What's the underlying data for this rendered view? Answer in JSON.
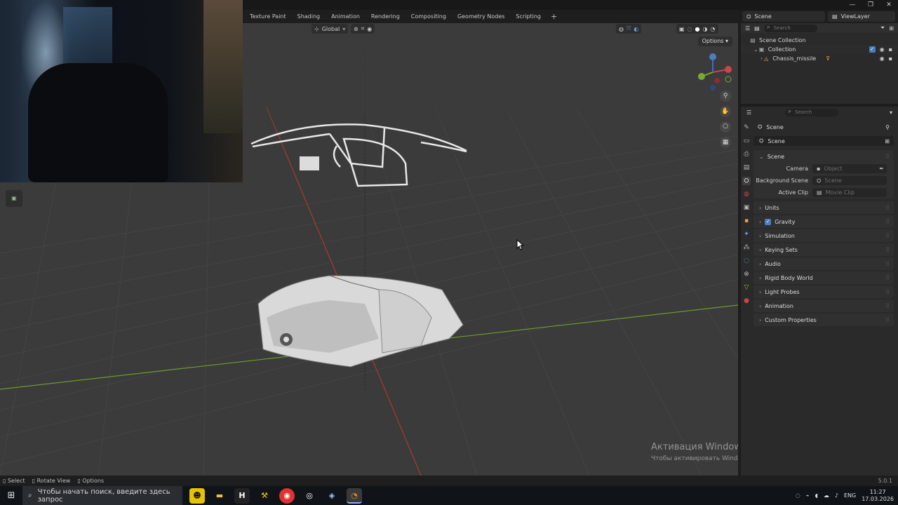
{
  "window": {
    "min": "—",
    "restore": "❐",
    "close": "✕"
  },
  "workspace_tabs": [
    "Texture Paint",
    "Shading",
    "Animation",
    "Rendering",
    "Compositing",
    "Geometry Nodes",
    "Scripting"
  ],
  "top_right": {
    "scene": "Scene",
    "view_layer": "ViewLayer"
  },
  "viewport": {
    "transform_orientation": "Global",
    "options": "Options",
    "gizmo_axes": [
      "X",
      "Y",
      "Z"
    ],
    "watermark_title": "Активация Windows",
    "watermark_sub": "Чтобы активировать Windows, перейдите в раздел \"Параметры\"."
  },
  "outliner": {
    "search_placeholder": "Search",
    "scene_collection": "Scene Collection",
    "collection": "Collection",
    "object": "Chassis_missile"
  },
  "properties": {
    "search_placeholder": "Search",
    "breadcrumb": "Scene",
    "scene_name": "Scene",
    "panels": {
      "scene": "Scene",
      "camera_label": "Camera",
      "camera_value": "Object",
      "bg_label": "Background Scene",
      "bg_value": "Scene",
      "clip_label": "Active Clip",
      "clip_value": "Movie Clip"
    },
    "sections": [
      "Units",
      "Gravity",
      "Simulation",
      "Keying Sets",
      "Audio",
      "Rigid Body World",
      "Light Probes",
      "Animation",
      "Custom Properties"
    ]
  },
  "statusbar": {
    "select": "Select",
    "rotate": "Rotate View",
    "options": "Options",
    "version": "5.0.1"
  },
  "taskbar": {
    "search": "Чтобы начать поиск, введите здесь запрос",
    "lang": "ENG",
    "time": "11:27",
    "date": "17.03.2026"
  },
  "colors": {
    "axis_x": "#c0392b",
    "axis_y": "#6c9a2c",
    "accent": "#4a7dc4"
  }
}
